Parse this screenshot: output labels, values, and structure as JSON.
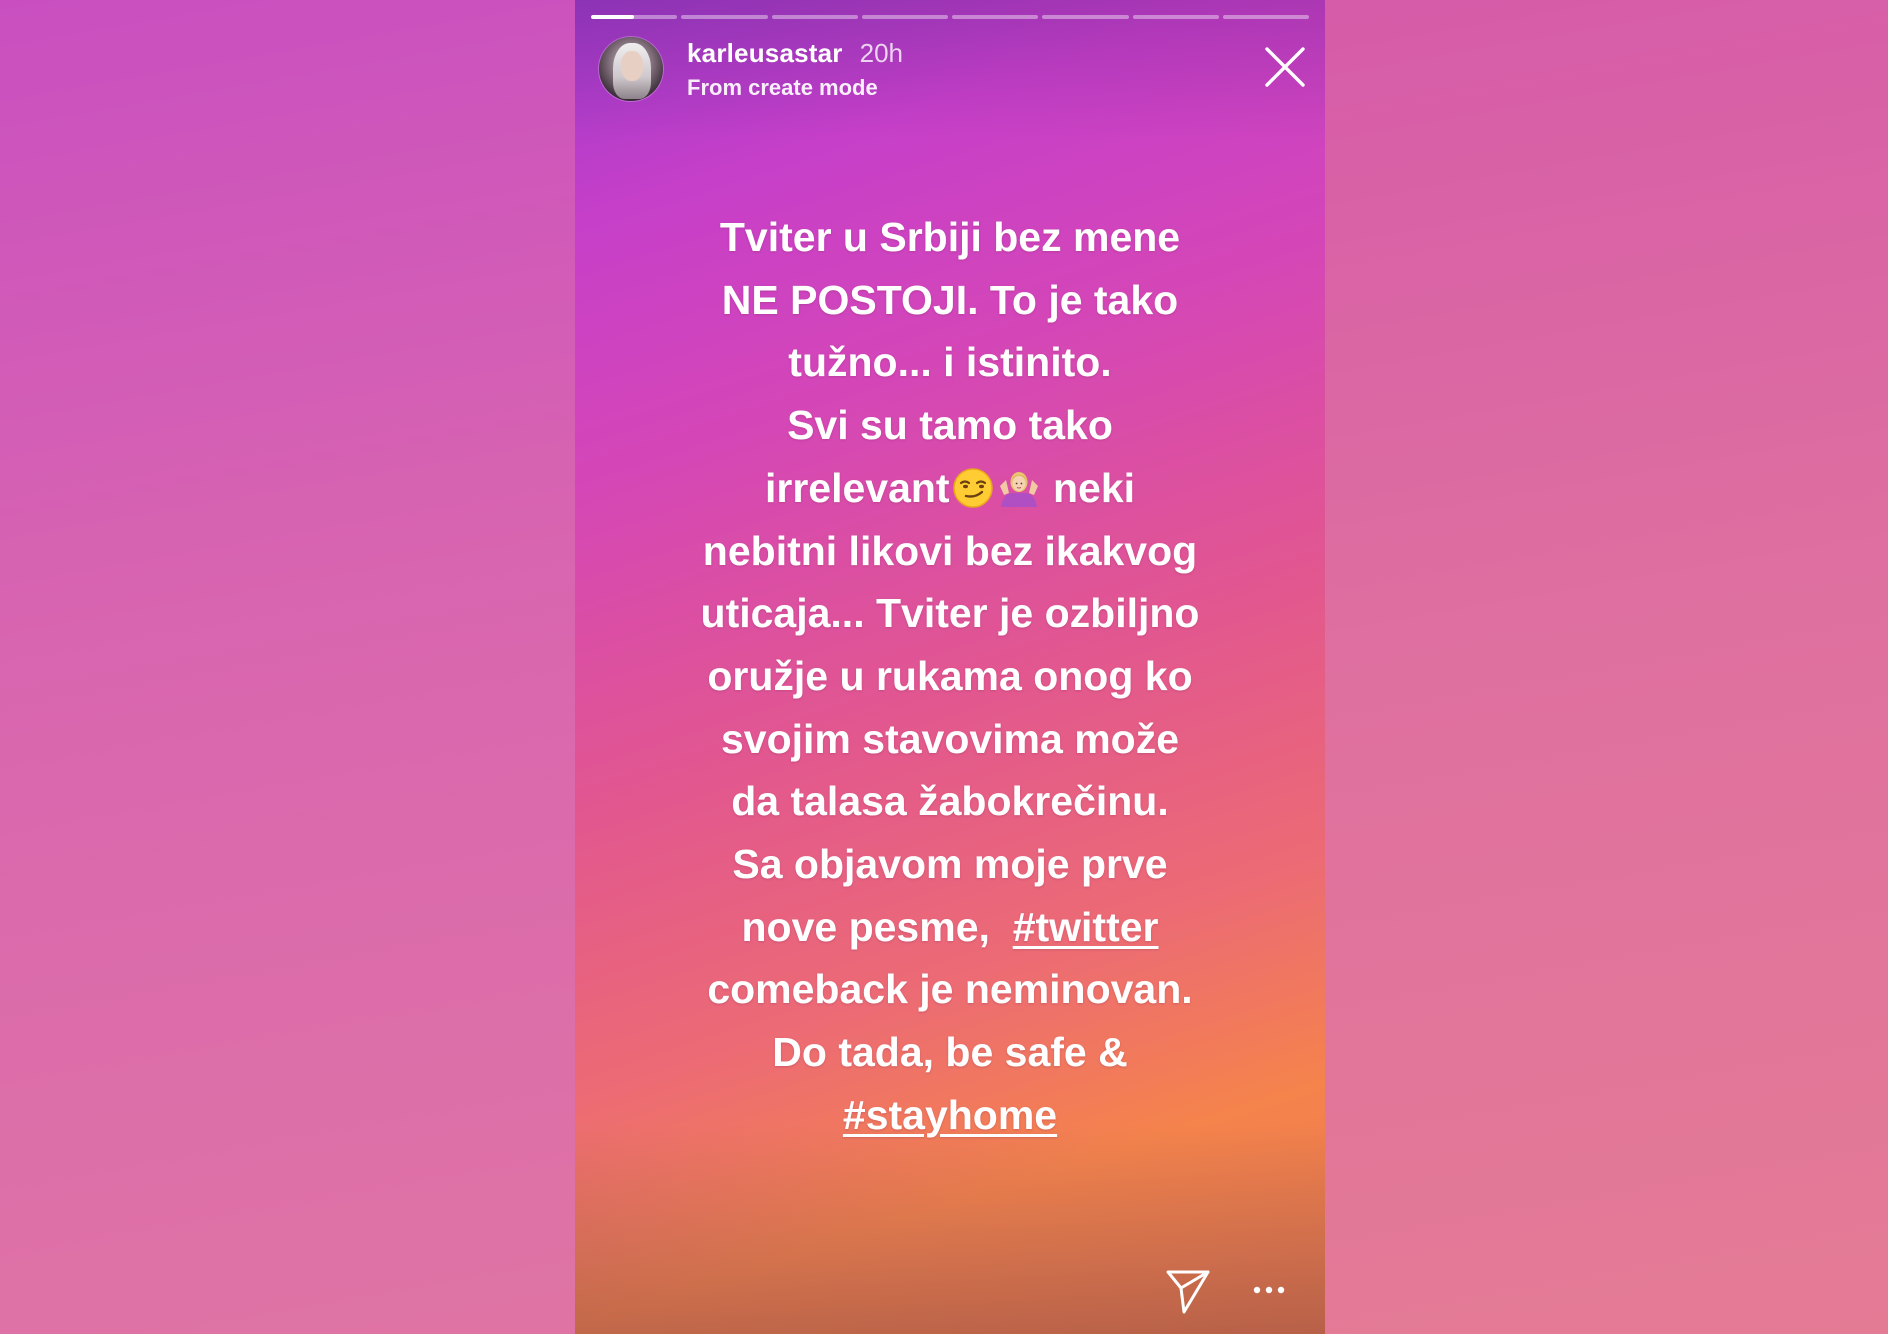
{
  "colors": {
    "story_gradient_top": "#9d3aca",
    "story_gradient_mid": "#e2578f",
    "story_gradient_bottom": "#f5834c",
    "text": "#ffffff"
  },
  "progress": {
    "segment_count": 8,
    "active_index": 0,
    "active_fill_fraction": 0.5
  },
  "header": {
    "username": "karleusastar",
    "time": "20h",
    "subtitle": "From create mode",
    "avatar_icon": "profile-avatar",
    "close_icon": "close-icon"
  },
  "story": {
    "line_1": "Tviter u Srbiji bez mene",
    "line_2": "NE POSTOJI. To je tako",
    "line_3": "tužno... i istinito.",
    "line_4": "Svi su tamo tako",
    "line_5_text": "irrelevant",
    "line_5_emoji_1": "smirking-face-emoji",
    "line_5_emoji_2": "person-shrugging-emoji",
    "line_5_after": "neki",
    "line_6": "nebitni likovi bez ikakvog",
    "line_7": "uticaja... Tviter je ozbiljno",
    "line_8": "oružje u rukama onog ko",
    "line_9": "svojim stavovima može",
    "line_10": "da talasa žabokrečinu.",
    "line_11": "Sa objavom moje prve",
    "line_12_text": "nove pesme,",
    "hashtag_twitter": "#twitter",
    "line_13": "comeback je neminovan.",
    "line_14": "Do tada, be safe &",
    "hashtag_stayhome": "#stayhome"
  },
  "footer": {
    "share_icon": "send-icon",
    "more_icon": "more-options-icon"
  }
}
